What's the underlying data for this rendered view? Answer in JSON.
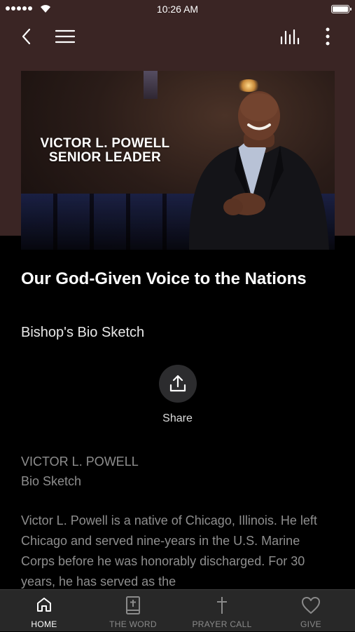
{
  "status_bar": {
    "time": "10:26 AM"
  },
  "nav": {
    "back_icon": "chevron-left-icon",
    "menu_icon": "hamburger-menu-icon",
    "audio_icon": "audio-bars-icon",
    "more_icon": "vertical-ellipsis-icon"
  },
  "hero": {
    "title_line1": "VICTOR L. POWELL",
    "title_line2": "SENIOR LEADER"
  },
  "content": {
    "title": "Our God-Given Voice to the Nations",
    "subtitle": "Bishop's Bio Sketch",
    "share_label": "Share",
    "author": "VICTOR L. POWELL",
    "section": "Bio Sketch",
    "body": "Victor L. Powell is a native of Chicago, Illinois. He left Chicago and served nine-years in the U.S. Marine Corps before he was honorably discharged. For 30 years, he has served as the"
  },
  "tabs": [
    {
      "label": "HOME",
      "icon": "home-icon",
      "active": true
    },
    {
      "label": "THE WORD",
      "icon": "bible-icon",
      "active": false
    },
    {
      "label": "PRAYER CALL",
      "icon": "cross-icon",
      "active": false
    },
    {
      "label": "GIVE",
      "icon": "heart-icon",
      "active": false
    }
  ],
  "colors": {
    "header_bg": "#3a2524",
    "page_bg": "#000000",
    "tab_bar_bg": "#282828",
    "muted_text": "#8e8e8e"
  }
}
